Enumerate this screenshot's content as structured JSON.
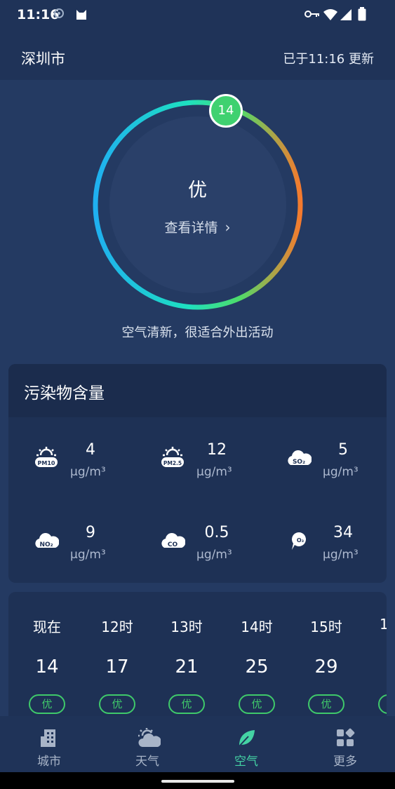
{
  "status_bar": {
    "time": "11:16"
  },
  "header": {
    "city": "深圳市",
    "updated": "已于11:16 更新"
  },
  "aqi": {
    "value": "14",
    "value_fraction": 0.03,
    "level": "优",
    "detail_link": "查看详情",
    "advice": "空气清新，很适合外出活动"
  },
  "pollutants": {
    "title": "污染物含量",
    "items": [
      {
        "name": "PM10",
        "value": "4",
        "unit": "μg/m³"
      },
      {
        "name": "PM2.5",
        "value": "12",
        "unit": "μg/m³"
      },
      {
        "name": "SO₂",
        "value": "5",
        "unit": "μg/m³"
      },
      {
        "name": "NO₂",
        "value": "9",
        "unit": "μg/m³"
      },
      {
        "name": "CO",
        "value": "0.5",
        "unit": "μg/m³"
      },
      {
        "name": "O₃",
        "value": "34",
        "unit": "μg/m³"
      }
    ]
  },
  "hourly": [
    {
      "time": "现在",
      "value": "14",
      "level": "优"
    },
    {
      "time": "12时",
      "value": "17",
      "level": "优"
    },
    {
      "time": "13时",
      "value": "21",
      "level": "优"
    },
    {
      "time": "14时",
      "value": "25",
      "level": "优"
    },
    {
      "time": "15时",
      "value": "29",
      "level": "优"
    },
    {
      "time": "1",
      "value": "",
      "level": ""
    }
  ],
  "tabs": [
    {
      "label": "城市",
      "icon": "building-icon",
      "active": false
    },
    {
      "label": "天气",
      "icon": "cloud-sun-icon",
      "active": false
    },
    {
      "label": "空气",
      "icon": "leaf-icon",
      "active": true
    },
    {
      "label": "更多",
      "icon": "apps-icon",
      "active": false
    }
  ],
  "colors": {
    "background": "#243a62",
    "card": "#1e3155",
    "good_green": "#3fd170",
    "active_tab": "#44d3a4",
    "ring_start": "#1fb0f0",
    "ring_end": "#f57a2e"
  }
}
